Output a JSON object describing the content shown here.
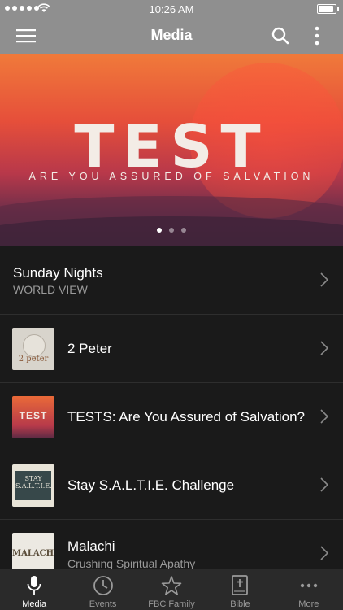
{
  "status_bar": {
    "time": "10:26 AM",
    "battery_level": 1.0
  },
  "header": {
    "title": "Media",
    "icons": [
      "menu-icon",
      "search-icon",
      "more-vertical-icon"
    ]
  },
  "hero": {
    "title": "TEST",
    "subtitle": "ARE YOU ASSURED OF SALVATION",
    "pages": 3,
    "active_page": 1
  },
  "list": {
    "featured": {
      "title": "Sunday Nights",
      "subtitle": "WORLD VIEW"
    },
    "items": [
      {
        "title": "2 Peter",
        "thumb_text": "2 peter"
      },
      {
        "title": "TESTS: Are You Assured of Salvation?",
        "thumb_text": "TEST"
      },
      {
        "title": "Stay S.A.L.T.I.E. Challenge",
        "thumb_text": "STAY S.A.L.T.I.E."
      },
      {
        "title": "Malachi",
        "subtitle": "Crushing Spiritual Apathy",
        "thumb_text": "MALACHI"
      }
    ]
  },
  "tabbar": {
    "tabs": [
      {
        "label": "Media",
        "icon": "microphone-icon",
        "active": true
      },
      {
        "label": "Events",
        "icon": "clock-icon",
        "active": false
      },
      {
        "label": "FBC Family",
        "icon": "star-icon",
        "active": false
      },
      {
        "label": "Bible",
        "icon": "bible-icon",
        "active": false
      },
      {
        "label": "More",
        "icon": "more-horizontal-icon",
        "active": false
      }
    ]
  },
  "colors": {
    "bar_gray": "#8f8f8f",
    "background": "#1a1a1a",
    "tabbar": "#2a2a2a"
  }
}
